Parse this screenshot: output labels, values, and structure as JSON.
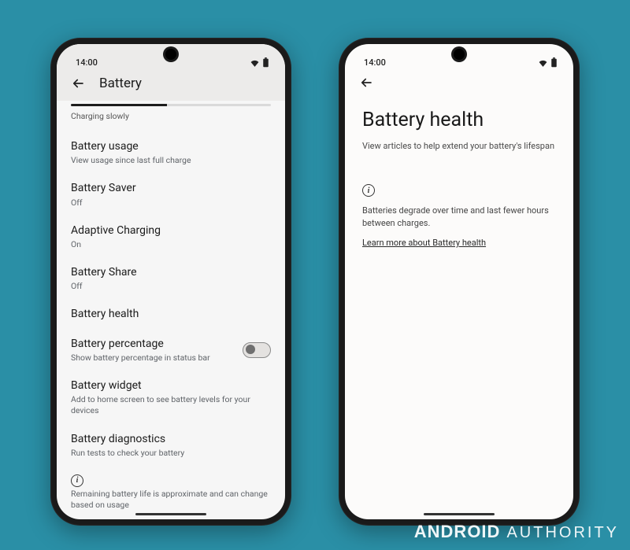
{
  "status": {
    "time": "14:00"
  },
  "left": {
    "appbar_title": "Battery",
    "charging_text": "Charging slowly",
    "progress_pct": 48,
    "rows": [
      {
        "title": "Battery usage",
        "subtitle": "View usage since last full charge"
      },
      {
        "title": "Battery Saver",
        "subtitle": "Off"
      },
      {
        "title": "Adaptive Charging",
        "subtitle": "On"
      },
      {
        "title": "Battery Share",
        "subtitle": "Off"
      },
      {
        "title": "Battery health",
        "subtitle": ""
      },
      {
        "title": "Battery percentage",
        "subtitle": "Show battery percentage in status bar"
      },
      {
        "title": "Battery widget",
        "subtitle": "Add to home screen to see battery levels for your devices"
      },
      {
        "title": "Battery diagnostics",
        "subtitle": "Run tests to check your battery"
      }
    ],
    "percentage_toggle_on": false,
    "footer": "Remaining battery life is approximate and can change based on usage"
  },
  "right": {
    "title": "Battery health",
    "subtitle": "View articles to help extend your battery's lifespan",
    "info_body": "Batteries degrade over time and last fewer hours between charges.",
    "link": "Learn more about Battery health"
  },
  "watermark": {
    "brand_a": "ANDROID",
    "brand_b": "AUTHORITY"
  }
}
